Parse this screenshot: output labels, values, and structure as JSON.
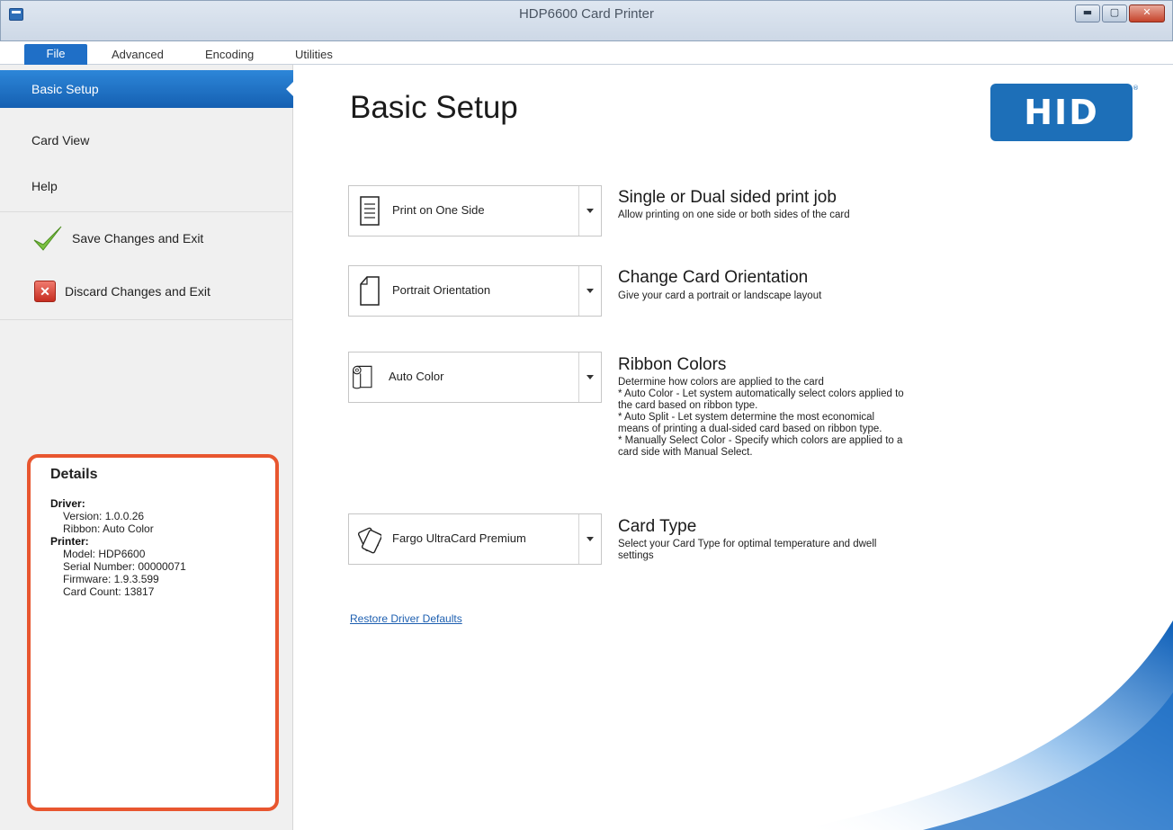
{
  "window": {
    "title": "HDP6600 Card Printer",
    "minimize_glyph": "▬",
    "maximize_glyph": "▢",
    "close_glyph": "✕"
  },
  "tabs": [
    "File",
    "Advanced",
    "Encoding",
    "Utilities"
  ],
  "sidebar": {
    "items": [
      "Basic Setup",
      "Card View",
      "Help"
    ],
    "save_label": "Save Changes and Exit",
    "discard_label": "Discard Changes and Exit",
    "discard_glyph": "✕"
  },
  "details": {
    "title": "Details",
    "driver_label": "Driver:",
    "driver_version": "Version: 1.0.0.26",
    "driver_ribbon": "Ribbon: Auto Color",
    "printer_label": "Printer:",
    "printer_model": "Model: HDP6600",
    "printer_serial": "Serial Number: 00000071",
    "printer_firmware": "Firmware: 1.9.3.599",
    "printer_card_count": "Card Count: 13817"
  },
  "main": {
    "title": "Basic Setup",
    "logo_text": "HID",
    "logo_reg": "®",
    "options": [
      {
        "selected": "Print on One Side",
        "icon": "document-icon",
        "title": "Single or Dual sided print job",
        "desc": [
          "Allow printing on one side or both sides of the card"
        ]
      },
      {
        "selected": "Portrait Orientation",
        "icon": "page-icon",
        "title": "Change Card Orientation",
        "desc": [
          "Give your card a portrait or landscape layout"
        ]
      },
      {
        "selected": "Auto Color",
        "icon": "ribbon-icon",
        "title": "Ribbon Colors",
        "desc": [
          "Determine how colors are applied to the card",
          "* Auto Color - Let system automatically select colors applied to",
          "the card based on ribbon type.",
          "* Auto Split - Let system determine the most economical",
          "means of printing a dual-sided card based on ribbon type.",
          "* Manually Select Color - Specify which colors are applied to a",
          "card side with Manual Select."
        ]
      },
      {
        "selected": "Fargo UltraCard Premium",
        "icon": "cards-icon",
        "title": "Card Type",
        "desc": [
          "Select your Card Type for optimal temperature and dwell",
          "settings"
        ]
      }
    ],
    "restore_link": "Restore Driver Defaults"
  },
  "colors": {
    "accent": "#1f6fc7",
    "details_border": "#e8562f",
    "logo": "#1d6fb8"
  }
}
